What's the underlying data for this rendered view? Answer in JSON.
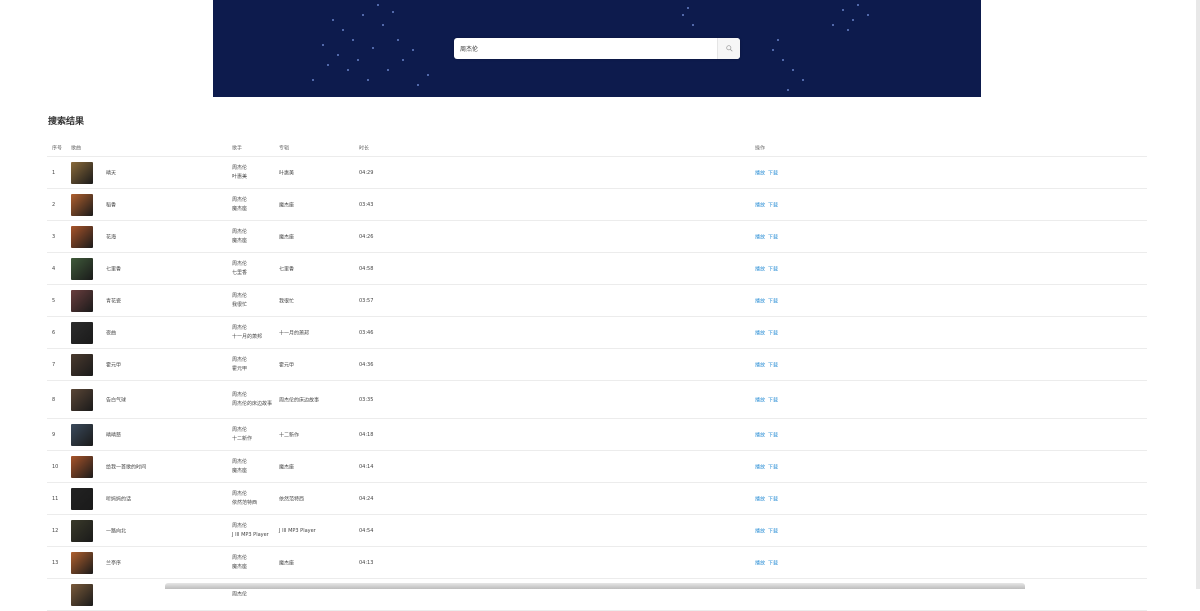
{
  "search": {
    "value": "周杰伦"
  },
  "results": {
    "title": "搜索结果",
    "headers": {
      "idx": "序号",
      "song": "歌曲",
      "artist": "歌手",
      "album": "专辑",
      "duration": "时长",
      "ops": "操作"
    },
    "rows": [
      {
        "idx": "1",
        "name": "晴天",
        "artist": [
          "周杰伦",
          "叶惠美"
        ],
        "album": "叶惠美",
        "duration": "04:29",
        "play": "播放",
        "download": "下载",
        "color": "#8a6a3a"
      },
      {
        "idx": "2",
        "name": "稻香",
        "artist": [
          "周杰伦",
          "魔杰座"
        ],
        "album": "魔杰座",
        "duration": "03:43",
        "play": "播放",
        "download": "下载",
        "color": "#b0602e"
      },
      {
        "idx": "3",
        "name": "花海",
        "artist": [
          "周杰伦",
          "魔杰座"
        ],
        "album": "魔杰座",
        "duration": "04:26",
        "play": "播放",
        "download": "下载",
        "color": "#a8542a"
      },
      {
        "idx": "4",
        "name": "七里香",
        "artist": [
          "周杰伦",
          "七里香"
        ],
        "album": "七里香",
        "duration": "04:58",
        "play": "播放",
        "download": "下载",
        "color": "#3f5a3a"
      },
      {
        "idx": "5",
        "name": "青花瓷",
        "artist": [
          "周杰伦",
          "我很忙"
        ],
        "album": "我很忙",
        "duration": "03:57",
        "play": "播放",
        "download": "下载",
        "color": "#6a3e3e"
      },
      {
        "idx": "6",
        "name": "夜曲",
        "artist": [
          "周杰伦",
          "十一月的萧邦"
        ],
        "album": "十一月的萧邦",
        "duration": "03:46",
        "play": "播放",
        "download": "下载",
        "color": "#2c2c2c"
      },
      {
        "idx": "7",
        "name": "霍元甲",
        "artist": [
          "周杰伦",
          "霍元甲"
        ],
        "album": "霍元甲",
        "duration": "04:36",
        "play": "播放",
        "download": "下载",
        "color": "#4a3a2e"
      },
      {
        "idx": "8",
        "name": "告白气球",
        "artist": [
          "周杰伦",
          "周杰伦的床边故事"
        ],
        "album": "周杰伦的床边故事",
        "duration": "03:35",
        "play": "播放",
        "download": "下载",
        "color": "#5a4636"
      },
      {
        "idx": "9",
        "name": "晴晴慈",
        "artist": [
          "周杰伦",
          "十二新作"
        ],
        "album": "十二新作",
        "duration": "04:18",
        "play": "播放",
        "download": "下载",
        "color": "#3a4a5c"
      },
      {
        "idx": "10",
        "name": "给我一首歌的时间",
        "artist": [
          "周杰伦",
          "魔杰座"
        ],
        "album": "魔杰座",
        "duration": "04:14",
        "play": "播放",
        "download": "下载",
        "color": "#a8542a"
      },
      {
        "idx": "11",
        "name": "听妈妈的话",
        "artist": [
          "周杰伦",
          "依然范特西"
        ],
        "album": "依然范特西",
        "duration": "04:24",
        "play": "播放",
        "download": "下载",
        "color": "#222222"
      },
      {
        "idx": "12",
        "name": "一路向北",
        "artist": [
          "周杰伦",
          "J III MP3 Player"
        ],
        "album": "J III MP3 Player",
        "duration": "04:54",
        "play": "播放",
        "download": "下载",
        "color": "#3a3a2a"
      },
      {
        "idx": "13",
        "name": "兰亭序",
        "artist": [
          "周杰伦",
          "魔杰座"
        ],
        "album": "魔杰座",
        "duration": "04:13",
        "play": "播放",
        "download": "下载",
        "color": "#b0602e"
      },
      {
        "idx": "",
        "name": "",
        "artist": [
          "周杰伦"
        ],
        "album": "",
        "duration": "",
        "play": "",
        "download": "",
        "color": "#7a5a3a"
      }
    ]
  }
}
